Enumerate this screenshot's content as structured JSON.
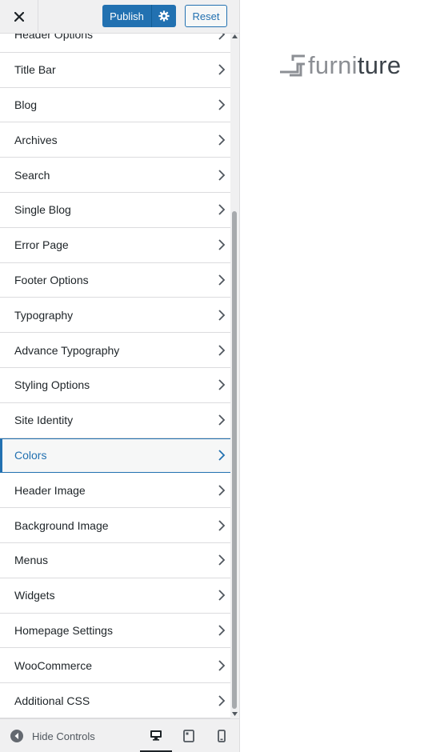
{
  "header": {
    "publish_label": "Publish",
    "reset_label": "Reset"
  },
  "menu": {
    "items": [
      {
        "label": "Header Options"
      },
      {
        "label": "Title Bar"
      },
      {
        "label": "Blog"
      },
      {
        "label": "Archives"
      },
      {
        "label": "Search"
      },
      {
        "label": "Single Blog"
      },
      {
        "label": "Error Page"
      },
      {
        "label": "Footer Options"
      },
      {
        "label": "Typography"
      },
      {
        "label": "Advance Typography"
      },
      {
        "label": "Styling Options"
      },
      {
        "label": "Site Identity"
      },
      {
        "label": "Colors",
        "active": true
      },
      {
        "label": "Header Image"
      },
      {
        "label": "Background Image"
      },
      {
        "label": "Menus"
      },
      {
        "label": "Widgets"
      },
      {
        "label": "Homepage Settings"
      },
      {
        "label": "WooCommerce"
      },
      {
        "label": "Additional CSS"
      }
    ]
  },
  "footer": {
    "hide_controls_label": "Hide Controls"
  },
  "preview": {
    "logo_part1": "furni",
    "logo_part2": "ture"
  },
  "colors": {
    "accent": "#2271b1",
    "panel_bg": "#f0f0f1",
    "text": "#1d2327"
  },
  "icons": {
    "close": "close-icon",
    "settings": "gear-icon",
    "chevron": "chevron-right-icon",
    "hide": "arrow-left-circle-icon",
    "desktop": "desktop-icon",
    "tablet": "tablet-icon",
    "mobile": "mobile-icon"
  }
}
